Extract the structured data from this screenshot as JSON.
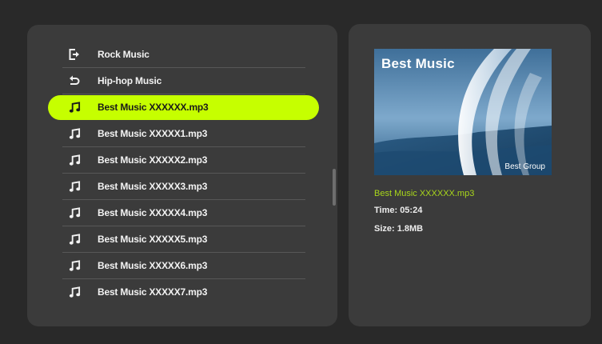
{
  "colors": {
    "background": "#292929",
    "panel": "#3b3b3b",
    "highlight": "#c6ff00",
    "accent_text": "#a8d61b",
    "text": "#f2f2f2"
  },
  "file_list": {
    "items": [
      {
        "icon": "exit-icon",
        "label": "Rock Music"
      },
      {
        "icon": "back-arrow-icon",
        "label": "Hip-hop Music"
      },
      {
        "icon": "music-note-icon",
        "label": "Best Music XXXXXX.mp3",
        "selected": true
      },
      {
        "icon": "music-note-icon",
        "label": "Best Music XXXXX1.mp3"
      },
      {
        "icon": "music-note-icon",
        "label": "Best Music XXXXX2.mp3"
      },
      {
        "icon": "music-note-icon",
        "label": "Best Music XXXXX3.mp3"
      },
      {
        "icon": "music-note-icon",
        "label": "Best Music XXXXX4.mp3"
      },
      {
        "icon": "music-note-icon",
        "label": "Best Music XXXXX5.mp3"
      },
      {
        "icon": "music-note-icon",
        "label": "Best Music XXXXX6.mp3"
      },
      {
        "icon": "music-note-icon",
        "label": "Best Music XXXXX7.mp3"
      }
    ]
  },
  "details": {
    "cover_title": "Best Music",
    "cover_artist": "Best Group",
    "file_name": "Best Music XXXXXX.mp3",
    "time": "Time: 05:24",
    "size": "Size: 1.8MB"
  }
}
